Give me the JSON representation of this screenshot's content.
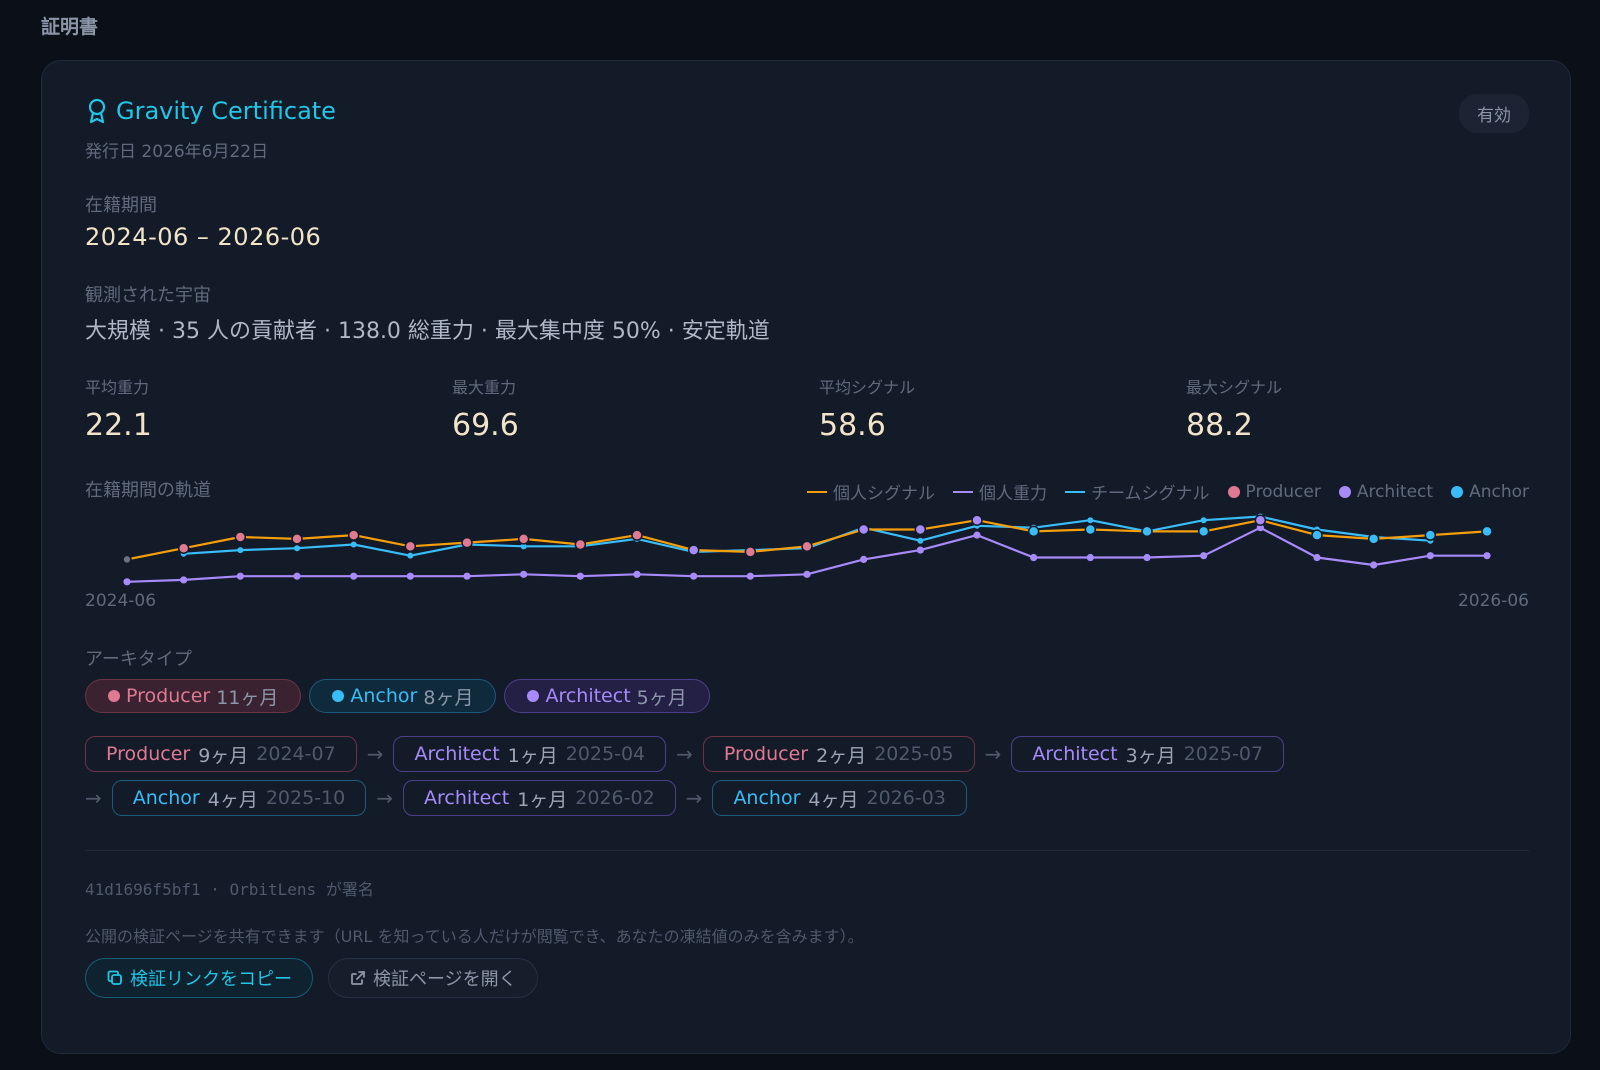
{
  "section_title": "証明書",
  "certificate": {
    "title": "Gravity Certificate",
    "issued": "発行日 2026年6月22日",
    "status": "有効"
  },
  "period": {
    "label": "在籍期間",
    "value": "2024-06 – 2026-06"
  },
  "universe": {
    "label": "観測された宇宙",
    "value": "大規模 · 35 人の貢献者 · 138.0 総重力 · 最大集中度 50% · 安定軌道"
  },
  "stats": [
    {
      "label": "平均重力",
      "value": "22.1"
    },
    {
      "label": "最大重力",
      "value": "69.6"
    },
    {
      "label": "平均シグナル",
      "value": "58.6"
    },
    {
      "label": "最大シグナル",
      "value": "88.2"
    }
  ],
  "trajectory": {
    "label": "在籍期間の軌道",
    "x_start": "2024-06",
    "x_end": "2026-06",
    "legend": [
      {
        "label": "個人シグナル",
        "kind": "line",
        "color": "#f59e0b"
      },
      {
        "label": "個人重力",
        "kind": "line",
        "color": "#a78bfa"
      },
      {
        "label": "チームシグナル",
        "kind": "line",
        "color": "#38bdf8"
      },
      {
        "label": "Producer",
        "kind": "dot",
        "color": "#e07a92"
      },
      {
        "label": "Architect",
        "kind": "dot",
        "color": "#a78bfa"
      },
      {
        "label": "Anchor",
        "kind": "dot",
        "color": "#38bdf8"
      }
    ]
  },
  "chart_data": {
    "type": "line",
    "x": [
      "2024-06",
      "2024-07",
      "2024-08",
      "2024-09",
      "2024-10",
      "2024-11",
      "2024-12",
      "2025-01",
      "2025-02",
      "2025-03",
      "2025-04",
      "2025-05",
      "2025-06",
      "2025-07",
      "2025-08",
      "2025-09",
      "2025-10",
      "2025-11",
      "2025-12",
      "2026-01",
      "2026-02",
      "2026-03",
      "2026-04",
      "2026-05",
      "2026-06"
    ],
    "ylim": [
      0,
      100
    ],
    "archetype_per_month": [
      null,
      "Producer",
      "Producer",
      "Producer",
      "Producer",
      "Producer",
      "Producer",
      "Producer",
      "Producer",
      "Producer",
      "Architect",
      "Producer",
      "Producer",
      "Architect",
      "Architect",
      "Architect",
      "Anchor",
      "Anchor",
      "Anchor",
      "Anchor",
      "Architect",
      "Anchor",
      "Anchor",
      "Anchor",
      "Anchor"
    ],
    "series": [
      {
        "name": "個人シグナル",
        "color": "#f59e0b",
        "values": [
          58,
          64,
          70,
          69,
          71,
          65,
          67,
          69,
          66,
          71,
          63,
          62,
          65,
          74,
          74,
          79,
          73,
          74,
          73,
          73,
          79,
          71,
          69,
          71,
          73
        ]
      },
      {
        "name": "個人重力",
        "color": "#a78bfa",
        "values": [
          46,
          47,
          49,
          49,
          49,
          49,
          49,
          50,
          49,
          50,
          49,
          49,
          50,
          58,
          63,
          71,
          59,
          59,
          59,
          60,
          75,
          59,
          55,
          60,
          60
        ]
      },
      {
        "name": "チームシグナル",
        "color": "#38bdf8",
        "values": [
          null,
          61,
          63,
          64,
          66,
          60,
          66,
          65,
          65,
          69,
          62,
          63,
          64,
          75,
          68,
          76,
          75,
          79,
          73,
          79,
          81,
          74,
          70,
          68,
          null
        ]
      }
    ]
  },
  "archetypes": {
    "label": "アーキタイプ",
    "chips": [
      {
        "name": "Producer",
        "duration": "11ヶ月"
      },
      {
        "name": "Anchor",
        "duration": "8ヶ月"
      },
      {
        "name": "Architect",
        "duration": "5ヶ月"
      }
    ]
  },
  "timeline": [
    {
      "name": "Producer",
      "duration": "9ヶ月",
      "start": "2024-07"
    },
    {
      "name": "Architect",
      "duration": "1ヶ月",
      "start": "2025-04"
    },
    {
      "name": "Producer",
      "duration": "2ヶ月",
      "start": "2025-05"
    },
    {
      "name": "Architect",
      "duration": "3ヶ月",
      "start": "2025-07"
    },
    {
      "name": "Anchor",
      "duration": "4ヶ月",
      "start": "2025-10"
    },
    {
      "name": "Architect",
      "duration": "1ヶ月",
      "start": "2026-02"
    },
    {
      "name": "Anchor",
      "duration": "4ヶ月",
      "start": "2026-03"
    }
  ],
  "footer": {
    "signature": "41d1696f5bf1 · OrbitLens が署名",
    "share_note": "公開の検証ページを共有できます（URL を知っている人だけが閲覧でき、あなたの凍結値のみを含みます）。",
    "copy_button": "検証リンクをコピー",
    "open_button": "検証ページを開く"
  }
}
